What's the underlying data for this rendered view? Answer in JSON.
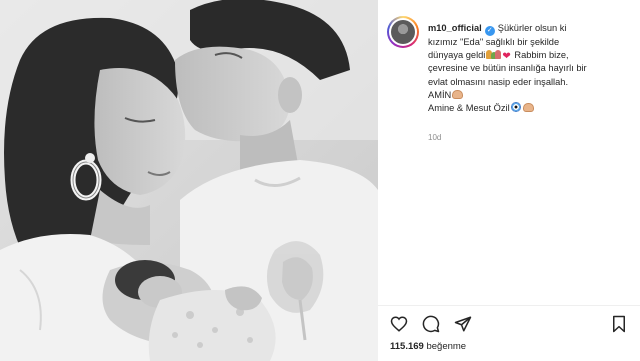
{
  "post": {
    "username": "m10_official",
    "caption_lines": [
      "Şükürler olsun ki",
      "kızımız \"Eda\" sağlıklı bir şekilde",
      "dünyaya geldi",
      "Rabbim bize,",
      "çevresine ve bütün insanlığa hayırlı bir",
      "evlat olmasını nasip eder inşallah.",
      "AMİN",
      "Amine & Mesut Özil"
    ],
    "time_ago": "10d",
    "likes_count": "115.169",
    "likes_label": "beğenme"
  },
  "icons": {
    "verified": "verified-badge-icon",
    "like": "heart-icon",
    "comment": "comment-icon",
    "share": "paper-plane-icon",
    "save": "bookmark-icon"
  },
  "colors": {
    "verified": "#3897f0",
    "text": "#262626",
    "muted": "#8e8e8e",
    "heart_emoji": "#e0245e"
  }
}
